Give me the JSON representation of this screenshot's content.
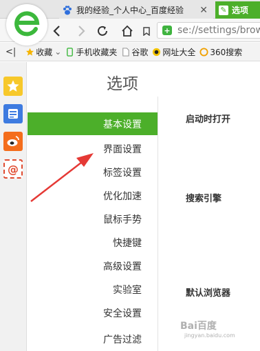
{
  "tabs": [
    {
      "title": "我的经验_个人中心_百度经验",
      "close": "✕"
    },
    {
      "title": "选项"
    }
  ],
  "nav": {
    "url": "se://settings/brow"
  },
  "bookmarks": {
    "collapse": "<|",
    "items": [
      {
        "label": "收藏",
        "dropdown": "⌄"
      },
      {
        "label": "手机收藏夹"
      },
      {
        "label": "谷歌"
      },
      {
        "label": "网址大全"
      },
      {
        "label": "360搜索"
      }
    ]
  },
  "settings": {
    "title": "选项",
    "menu": [
      "基本设置",
      "界面设置",
      "标签设置",
      "优化加速",
      "鼠标手势",
      "快捷键",
      "高级设置",
      "实验室",
      "安全设置",
      "广告过滤"
    ],
    "sections": [
      "启动时打开",
      "搜索引擎",
      "默认浏览器"
    ]
  },
  "watermark": {
    "text": "Bai百度",
    "sub": "jingyan.baidu.com"
  },
  "colors": {
    "accent": "#4caf2a",
    "arrow": "#e53935"
  }
}
